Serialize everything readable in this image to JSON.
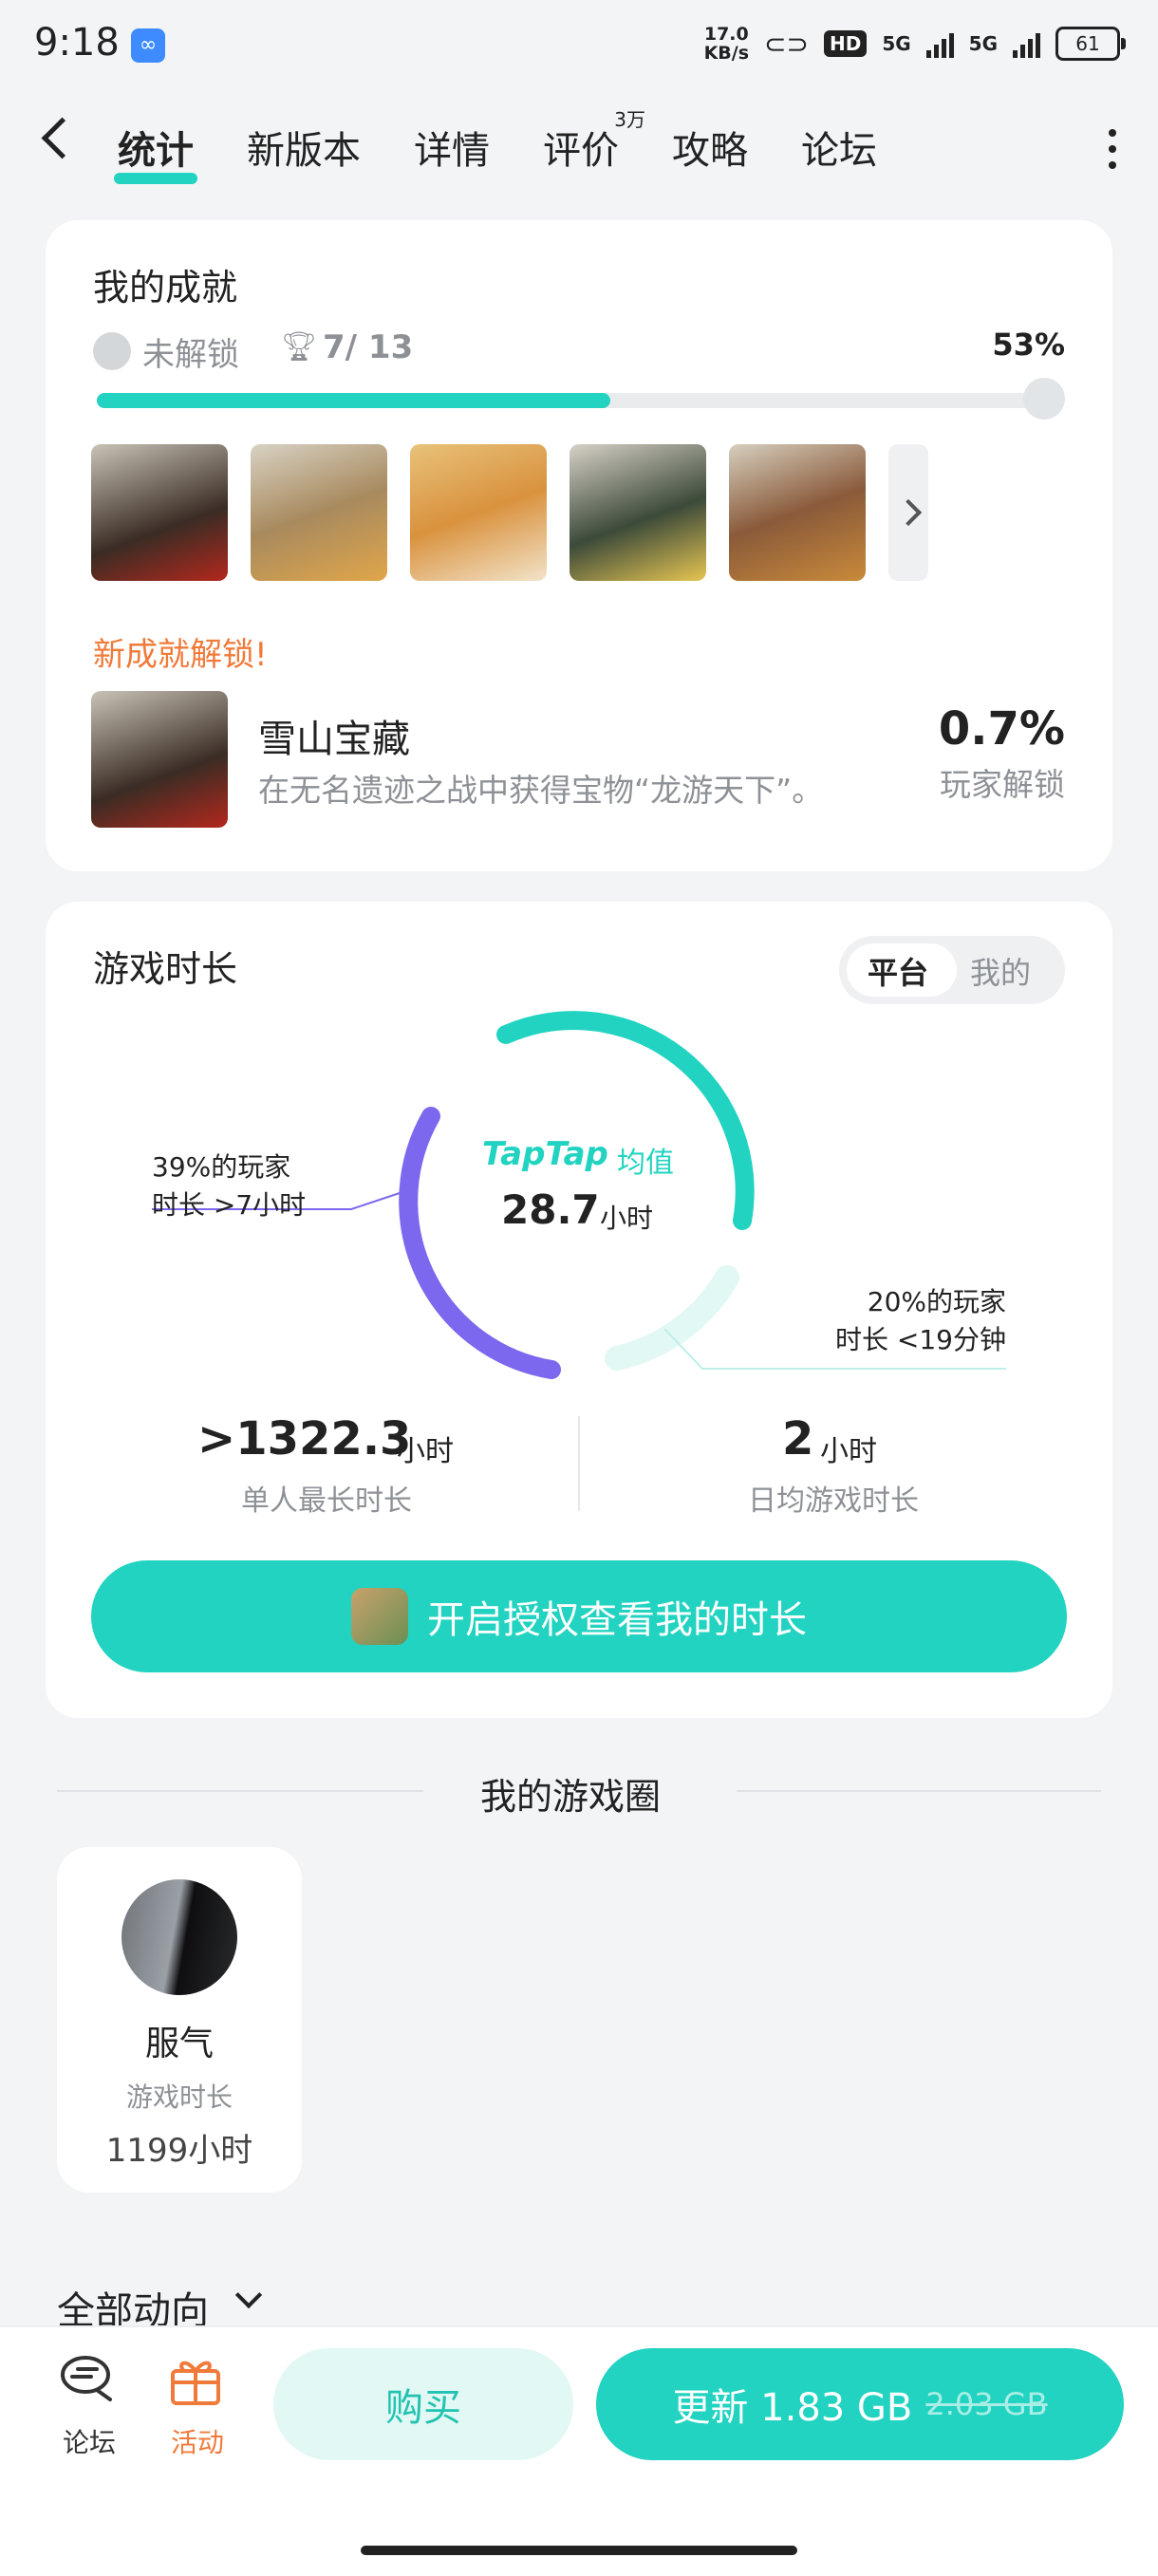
{
  "status": {
    "time": "9:18",
    "net_speed_value": "17.0",
    "net_speed_unit": "KB/s",
    "hd": "HD",
    "sig1": "5G",
    "sig2": "5G",
    "battery": "61"
  },
  "tabs": [
    {
      "label": "统计",
      "active": true
    },
    {
      "label": "新版本"
    },
    {
      "label": "详情"
    },
    {
      "label": "评价",
      "badge": "3万"
    },
    {
      "label": "攻略"
    },
    {
      "label": "论坛"
    }
  ],
  "achievements": {
    "title": "我的成就",
    "locked_label": "未解锁",
    "count": "7/ 13",
    "percent_text": "53%",
    "progress": 0.53,
    "new_label": "新成就解锁!",
    "new_name": "雪山宝藏",
    "new_desc": "在无名遗迹之战中获得宝物“龙游天下”。",
    "new_percent": "0.7%",
    "new_percent_label": "玩家解锁"
  },
  "playtime": {
    "title": "游戏时长",
    "toggle_platform": "平台",
    "toggle_mine": "我的",
    "brand": "TapTap",
    "brand_sub": "均值",
    "average": "28.7",
    "average_unit": "小时",
    "note_left_1": "39%的玩家",
    "note_left_2": "时长 >7小时",
    "note_right_1": "20%的玩家",
    "note_right_2": "时长 <19分钟",
    "max_value": ">1322.3",
    "max_unit": "小时",
    "max_label": "单人最长时长",
    "daily_value": "2",
    "daily_unit": "小时",
    "daily_label": "日均游戏时长",
    "auth_button": "开启授权查看我的时长"
  },
  "circle": {
    "title": "我的游戏圈",
    "friend_name": "服气",
    "friend_sub": "游戏时长",
    "friend_hours": "1199小时"
  },
  "feed": {
    "all_label": "全部动向"
  },
  "bottom": {
    "forum_label": "论坛",
    "activity_label": "活动",
    "buy_label": "购买",
    "update_label": "更新 1.83 GB",
    "update_old": "2.03 GB"
  },
  "colors": {
    "accent": "#21d3c0",
    "purple": "#7b68ee",
    "orange": "#f07a3a"
  }
}
